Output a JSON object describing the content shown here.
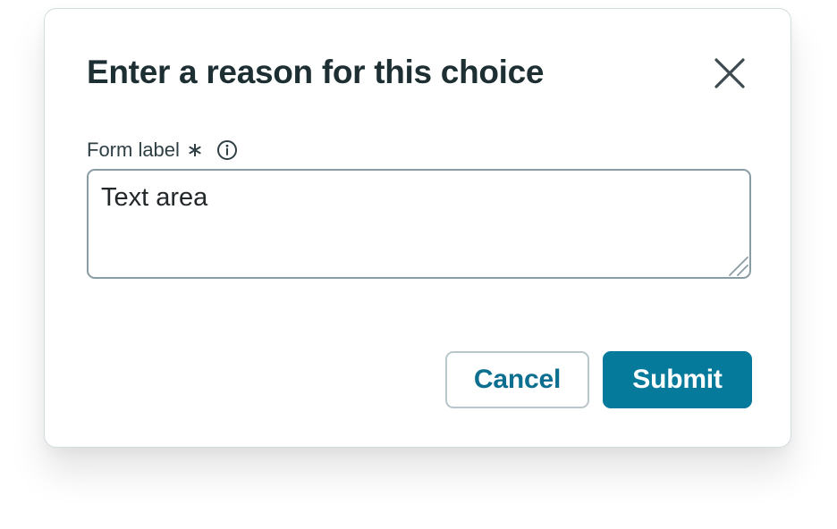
{
  "dialog": {
    "title": "Enter a reason for this choice",
    "close_icon": "close-icon"
  },
  "field": {
    "label": "Form label",
    "required": true,
    "required_icon": "asterisk-icon",
    "info_icon": "info-icon",
    "value": "Text area"
  },
  "actions": {
    "cancel_label": "Cancel",
    "submit_label": "Submit"
  },
  "colors": {
    "primary": "#057a9b",
    "primary_text": "#0c6f8f",
    "title_text": "#1d2f33",
    "border": "#d3dde0"
  }
}
